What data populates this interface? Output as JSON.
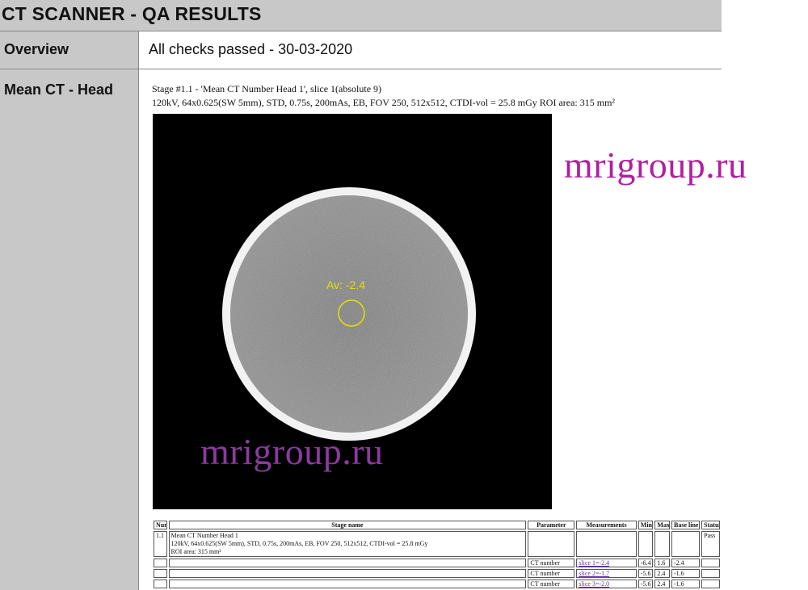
{
  "header": {
    "title": "CT SCANNER - QA RESULTS"
  },
  "overview": {
    "label": "Overview",
    "value": "All checks passed - 30-03-2020"
  },
  "mean_ct": {
    "label": "Mean CT - Head",
    "stage_line1": "Stage #1.1 - 'Mean CT Number Head 1',  slice 1(absolute 9)",
    "stage_line2": "120kV, 64x0.625(SW 5mm), STD, 0.75s, 200mAs, EB, FOV 250, 512x512, CTDI-vol = 25.8 mGy ROI area: 315 mm²",
    "image_annotation": "Av: -2.4"
  },
  "watermarks": {
    "right": "mrigroup.ru",
    "image": "mrigroup.ru"
  },
  "table": {
    "headers": [
      "Num",
      "Stage name",
      "Parameter",
      "Measurements",
      "Min",
      "Max",
      "Base line",
      "Status"
    ],
    "first_row": {
      "num": "1.1",
      "name": "Mean CT Number Head 1",
      "desc": "120kV, 64x0.625(SW 5mm), STD, 0.75s, 200mAs, EB, FOV 250, 512x512, CTDI-vol = 25.8 mGy",
      "roi": "ROI area: 315 mm²",
      "status": "Pass"
    },
    "rows": [
      {
        "param": "CT number",
        "measurement": "slice 1=-2.4",
        "min": "-6.4",
        "max": "1.6",
        "baseline": "-2.4"
      },
      {
        "param": "CT number",
        "measurement": "slice 2=-1.7",
        "min": "-5.6",
        "max": "2.4",
        "baseline": "-1.6"
      },
      {
        "param": "CT number",
        "measurement": "slice 3=-2.0",
        "min": "-5.6",
        "max": "2.4",
        "baseline": "-1.6"
      }
    ]
  },
  "colors": {
    "label_bg": "#c8c8c8",
    "watermark": "#b01fa0",
    "annotation": "#e6e000"
  }
}
